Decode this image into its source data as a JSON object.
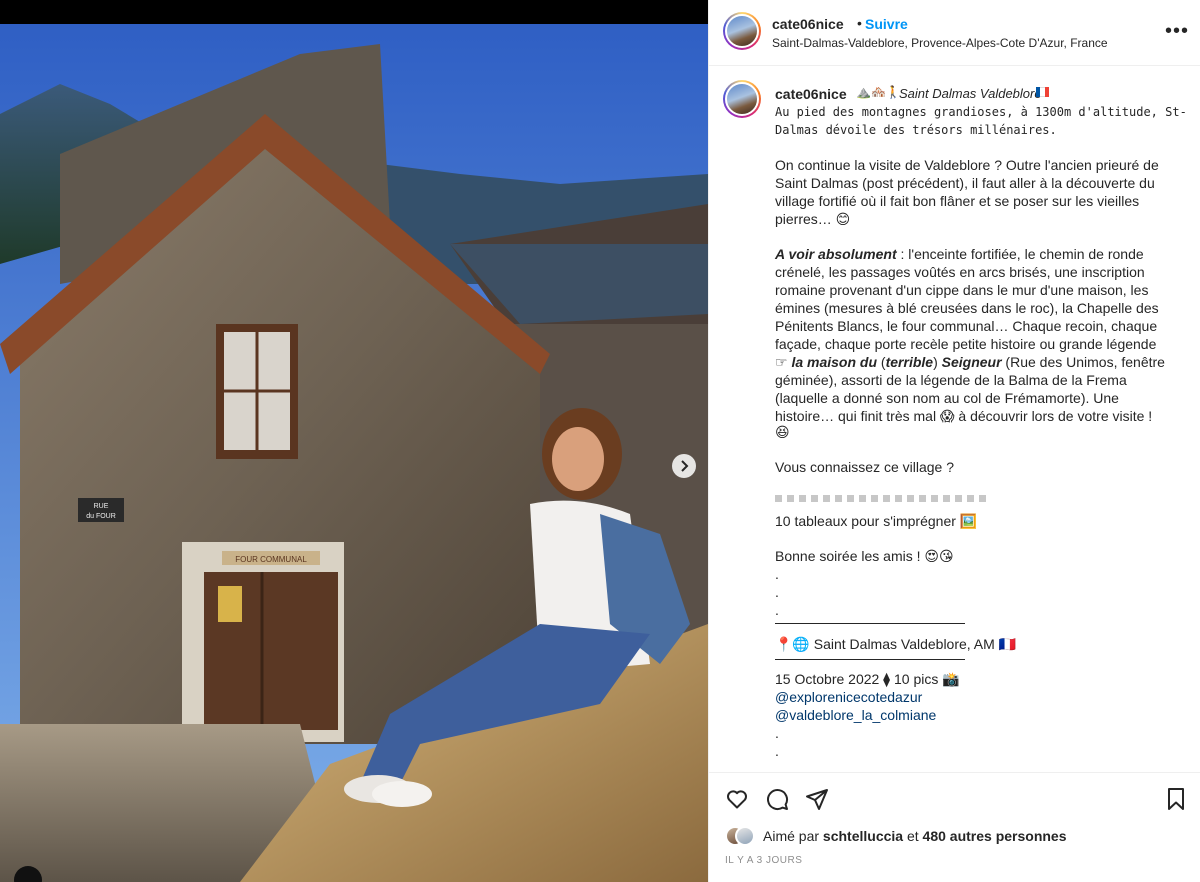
{
  "post": {
    "username": "cate06nice",
    "follow_label": "Suivre",
    "separator": "•",
    "location": "Saint-Dalmas-Valdeblore, Provence-Alpes-Cote D'Azur, France",
    "more_label": "•••"
  },
  "photo": {
    "sign_street": "RUE du FOUR",
    "sign_oven": "FOUR COMMUNAL",
    "next_arrow": "›"
  },
  "caption": {
    "username": "cate06nice",
    "emojis": "⛰️🏘️🚶",
    "title": "Saint Dalmas Valdeblore",
    "flag_colors": [
      "#0055a4",
      "#ffffff",
      "#ef4135"
    ],
    "lines": {
      "l1": "Au pied des montagnes grandioses, à 1300m d'altitude, St-",
      "l2": "Dalmas dévoile des trésors millénaires.",
      "l3": "On continue la visite de Valdeblore ? Outre l'ancien prieuré de",
      "l4": "Saint Dalmas (post précédent), il faut aller à la découverte du",
      "l5": "village fortifié où il fait bon flâner et se poser sur les vieilles",
      "l6": "pierres… 😊",
      "l7_label": "A voir absolument",
      "l7_rest": " : l'enceinte fortifiée, le chemin de ronde",
      "l8": "crénelé, les passages voûtés en arcs brisés, une inscription",
      "l9": "romaine provenant d'un cippe dans le mur d'une maison, les",
      "l10": "émines (mesures à blé creusées dans le roc), la Chapelle des",
      "l11": "Pénitents Blancs, le four communal… Chaque recoin, chaque",
      "l12": "façade, chaque porte recèle petite histoire ou grande légende",
      "l13_a": "☞ ",
      "l13_b": "la maison du",
      "l13_c": " (",
      "l13_d": "terrible",
      "l13_e": ") ",
      "l13_f": "Seigneur",
      "l13_g": " (Rue des Unimos, fenêtre",
      "l14": "géminée), assorti de la légende de la Balma de la Frema",
      "l15": "(laquelle a donné son nom au col de Frémamorte). Une",
      "l16": "histoire… qui finit très mal 😱 à découvrir lors de votre visite !",
      "l17": "😆",
      "l18": "Vous connaissez ce village ?",
      "l19": "10 tableaux pour s'imprégner 🖼️",
      "l20": "Bonne soirée les amis ! 😍😘",
      "dot": ".",
      "l21": "📍🌐 Saint Dalmas Valdeblore, AM 🇫🇷",
      "l22": "15 Octobre 2022 ⧫ 10 pics 📸",
      "link1": "@explorenicecotedazur",
      "link2": "@valdeblore_la_colmiane"
    }
  },
  "actions": {
    "liked_prefix": "Aimé par ",
    "liked_user": "schtelluccia",
    "liked_mid": " et ",
    "liked_others": "480 autres personnes",
    "date": "IL Y A 3 JOURS"
  }
}
